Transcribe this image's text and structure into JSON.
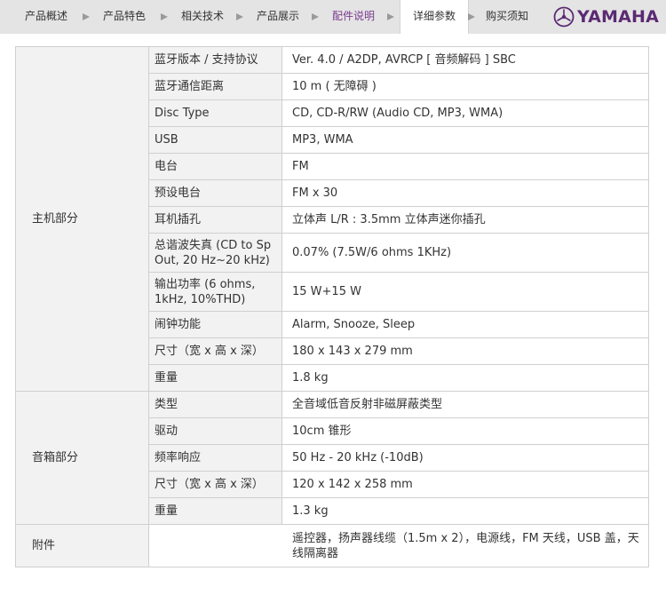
{
  "nav": {
    "tabs": [
      {
        "label": "产品概述"
      },
      {
        "label": "产品特色"
      },
      {
        "label": "相关技术"
      },
      {
        "label": "产品展示"
      },
      {
        "label": "配件说明"
      },
      {
        "label": "详细参数"
      },
      {
        "label": "购买须知"
      }
    ],
    "current_tab": "配件说明",
    "active_tab": "详细参数",
    "brand": "YAMAHA",
    "accent_color": "#7a3b8f"
  },
  "spec": {
    "main": {
      "group": "主机部分",
      "rows": [
        {
          "label": "蓝牙版本 / 支持协议",
          "value": "Ver. 4.0 / A2DP, AVRCP [ 音频解码 ] SBC"
        },
        {
          "label": "蓝牙通信距离",
          "value": "10 m ( 无障碍 )"
        },
        {
          "label": "Disc Type",
          "value": "CD, CD-R/RW (Audio CD, MP3, WMA)"
        },
        {
          "label": "USB",
          "value": "MP3, WMA"
        },
        {
          "label": "电台",
          "value": "FM"
        },
        {
          "label": "预设电台",
          "value": "FM x 30"
        },
        {
          "label": "耳机插孔",
          "value": "立体声 L/R : 3.5mm 立体声迷你插孔"
        },
        {
          "label": "总谐波失真 (CD to Sp Out, 20 Hz~20 kHz)",
          "value": "0.07% (7.5W/6 ohms 1KHz)"
        },
        {
          "label": "输出功率 (6 ohms, 1kHz, 10%THD)",
          "value": "15 W+15 W"
        },
        {
          "label": "闹钟功能",
          "value": "Alarm, Snooze, Sleep"
        },
        {
          "label": "尺寸（宽 x 高 x 深）",
          "value": "180 x 143 x 279 mm"
        },
        {
          "label": "重量",
          "value": "1.8 kg"
        }
      ]
    },
    "speaker": {
      "group": "音箱部分",
      "rows": [
        {
          "label": "类型",
          "value": "全音域低音反射非磁屏蔽类型"
        },
        {
          "label": "驱动",
          "value": "10cm 锥形"
        },
        {
          "label": "频率响应",
          "value": "50 Hz - 20 kHz (-10dB)"
        },
        {
          "label": "尺寸（宽 x 高 x 深）",
          "value": "120 x 142 x 258 mm"
        },
        {
          "label": "重量",
          "value": "1.3 kg"
        }
      ]
    },
    "accessories": {
      "group": "附件",
      "value": "遥控器，扬声器线缆（1.5m x 2），电源线，FM 天线，USB 盖，天线隔离器"
    }
  }
}
